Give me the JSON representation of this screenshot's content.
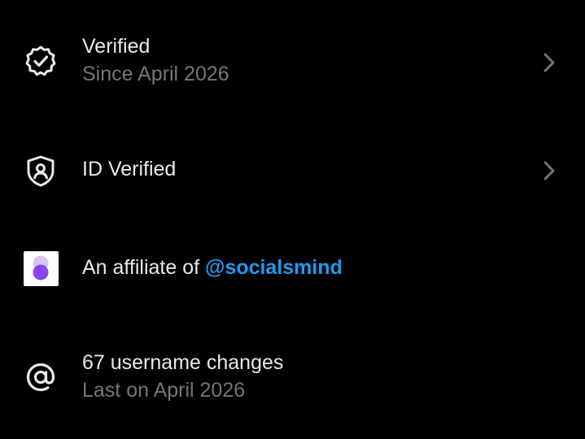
{
  "verified_row": {
    "title": "Verified",
    "subtitle": "Since April 2026",
    "icon": "verified-badge-icon"
  },
  "id_verified_row": {
    "title": "ID Verified",
    "icon": "shield-person-icon"
  },
  "affiliate_row": {
    "prefix": "An affiliate of ",
    "handle": "@socialsmind",
    "icon": "affiliate-logo",
    "handle_color": "#1d9bf0"
  },
  "username_row": {
    "title": "67 username changes",
    "subtitle": "Last on April 2026",
    "icon": "at-sign-icon"
  },
  "colors": {
    "background": "#000000",
    "primary_text": "#e7e9ea",
    "secondary_text": "#71767b",
    "accent": "#1d9bf0"
  }
}
